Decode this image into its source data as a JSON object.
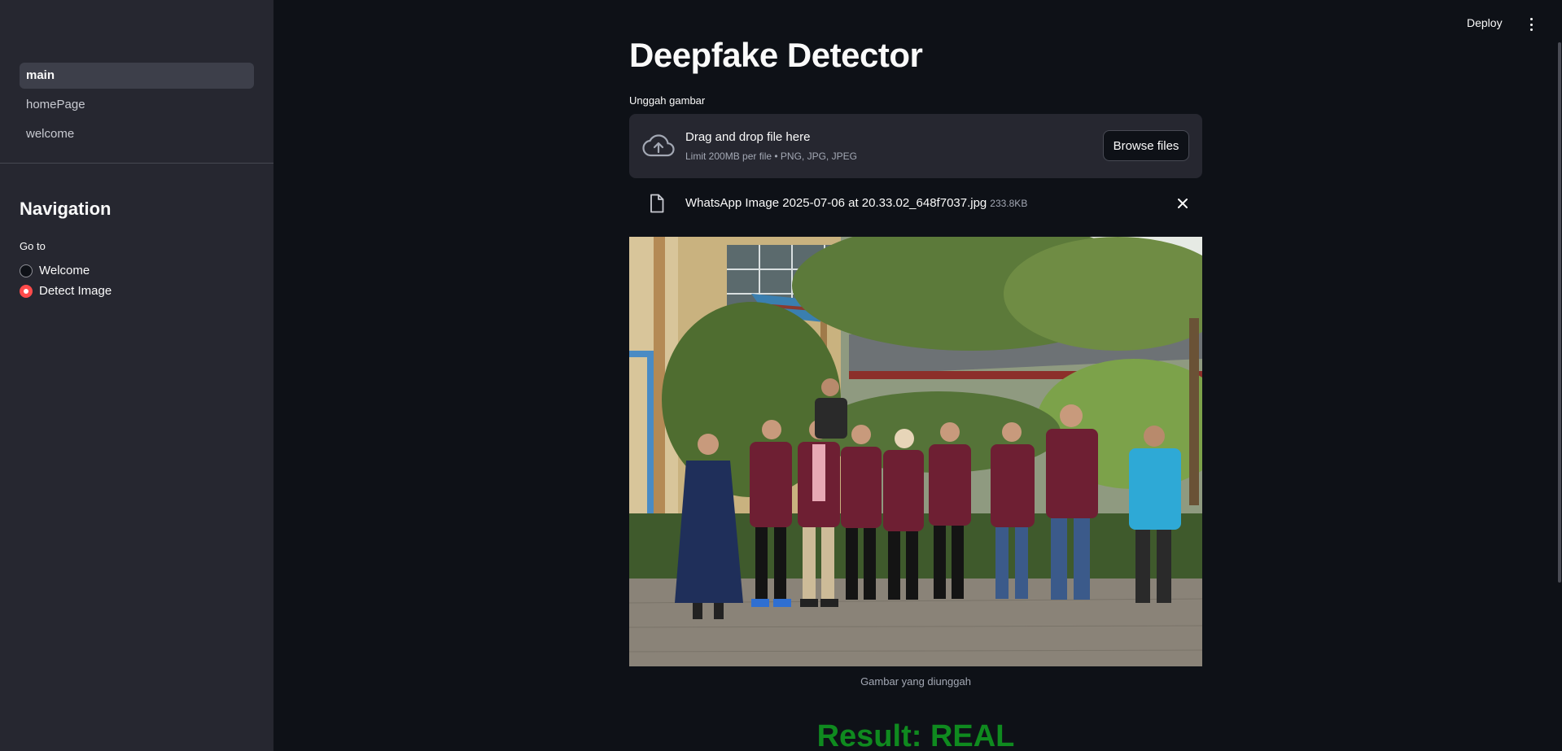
{
  "sidebar": {
    "pages": [
      {
        "label": "main",
        "active": true
      },
      {
        "label": "homePage",
        "active": false
      },
      {
        "label": "welcome",
        "active": false
      }
    ],
    "nav_title": "Navigation",
    "goto_label": "Go to",
    "radio_options": [
      {
        "label": "Welcome",
        "checked": false
      },
      {
        "label": "Detect Image",
        "checked": true
      }
    ]
  },
  "header": {
    "deploy_label": "Deploy",
    "menu_icon": "kebab-menu-icon"
  },
  "main": {
    "title": "Deepfake Detector",
    "upload_label": "Unggah gambar",
    "dropzone": {
      "title": "Drag and drop file here",
      "subtitle": "Limit 200MB per file • PNG, JPG, JPEG",
      "browse_label": "Browse files",
      "icon": "cloud-upload-icon"
    },
    "file": {
      "name": "WhatsApp Image 2025-07-06 at 20.33.02_648f7037.jpg",
      "size": "233.8KB",
      "icon": "file-icon"
    },
    "image_caption": "Gambar yang diunggah",
    "result": "Result: REAL"
  },
  "colors": {
    "background": "#0e1117",
    "sidebar": "#262730",
    "accent": "#ff4b4b",
    "result": "#0f8a1f"
  }
}
